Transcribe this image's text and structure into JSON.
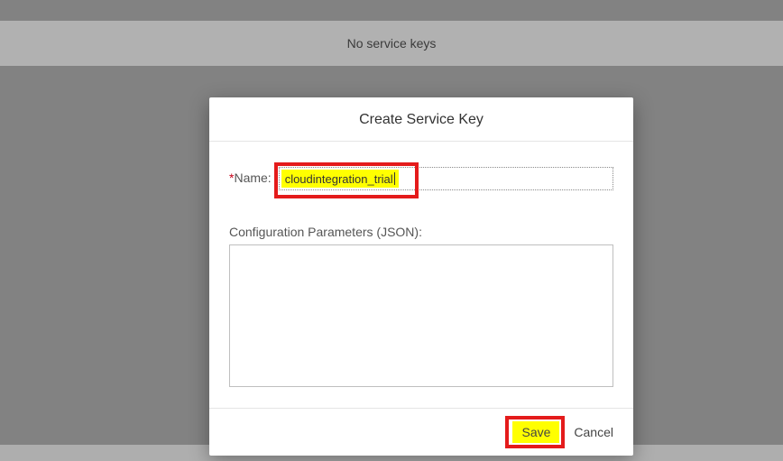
{
  "background": {
    "no_keys_text": "No service keys"
  },
  "modal": {
    "title": "Create Service Key",
    "required_marker": "*",
    "name_label": "Name:",
    "name_value": "cloudintegration_trial",
    "config_label": "Configuration Parameters (JSON):",
    "config_value": "",
    "save_label": "Save",
    "cancel_label": "Cancel"
  }
}
